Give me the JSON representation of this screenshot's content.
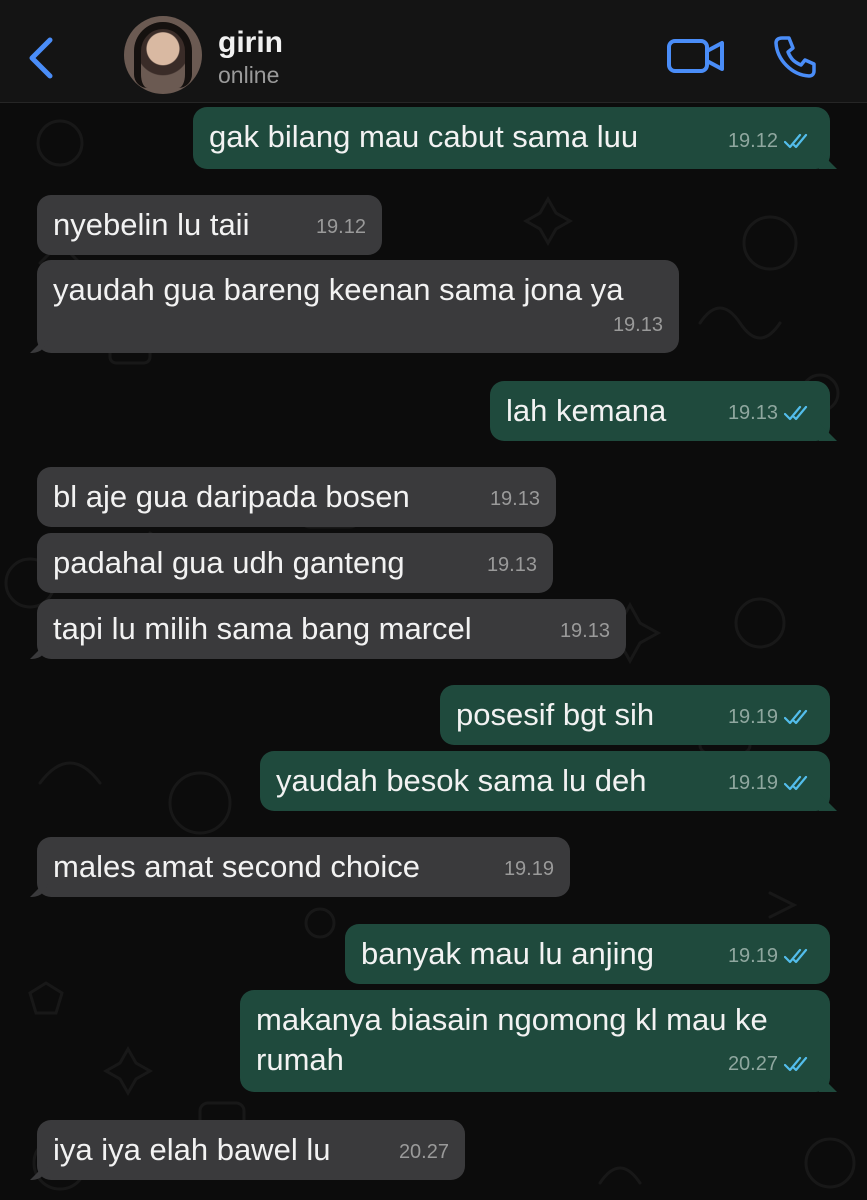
{
  "header": {
    "contact_name": "girin",
    "contact_status": "online",
    "back_icon": "chevron-left-icon",
    "video_icon": "video-camera-icon",
    "call_icon": "phone-icon",
    "accent_color": "#4a8df8"
  },
  "messages": [
    {
      "from": "me",
      "text": "gak bilang mau cabut sama luu",
      "time": "19.12",
      "read": true
    },
    {
      "from": "them",
      "text": "nyebelin lu taii",
      "time": "19.12"
    },
    {
      "from": "them",
      "text": "yaudah gua bareng keenan sama jona ya",
      "time": "19.13"
    },
    {
      "from": "me",
      "text": "lah kemana",
      "time": "19.13",
      "read": true
    },
    {
      "from": "them",
      "text": "bl aje gua daripada bosen",
      "time": "19.13"
    },
    {
      "from": "them",
      "text": "padahal gua udh ganteng",
      "time": "19.13"
    },
    {
      "from": "them",
      "text": "tapi lu milih sama bang marcel",
      "time": "19.13"
    },
    {
      "from": "me",
      "text": "posesif bgt sih",
      "time": "19.19",
      "read": true
    },
    {
      "from": "me",
      "text": "yaudah besok sama lu deh",
      "time": "19.19",
      "read": true
    },
    {
      "from": "them",
      "text": "males amat second choice",
      "time": "19.19"
    },
    {
      "from": "me",
      "text": "banyak mau lu anjing",
      "time": "19.19",
      "read": true
    },
    {
      "from": "me",
      "text": "makanya biasain ngomong kl mau ke rumah",
      "time": "20.27",
      "read": true
    },
    {
      "from": "them",
      "text": "iya iya elah bawel lu",
      "time": "20.27"
    }
  ],
  "colors": {
    "incoming_bubble": "#3a3a3c",
    "outgoing_bubble": "#1f4a3d",
    "read_ticks": "#53bdeb"
  }
}
